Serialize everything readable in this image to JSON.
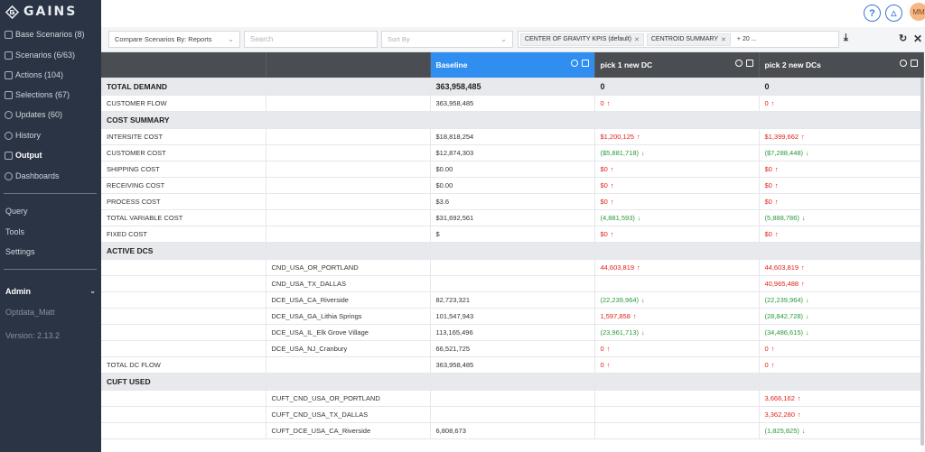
{
  "brand": {
    "name": "GAINS"
  },
  "sidebar": {
    "items": [
      {
        "label": "Base Scenarios (8)",
        "icon": "scenarios-icon"
      },
      {
        "label": "Scenarios (6/63)",
        "icon": "list-icon"
      },
      {
        "label": "Actions (104)",
        "icon": "actions-icon"
      },
      {
        "label": "Selections (67)",
        "icon": "selection-icon"
      },
      {
        "label": "Updates (60)",
        "icon": "refresh-icon"
      },
      {
        "label": "History",
        "icon": "history-icon"
      },
      {
        "label": "Output",
        "icon": "output-icon"
      },
      {
        "label": "Dashboards",
        "icon": "dashboard-icon"
      }
    ],
    "links": [
      "Query",
      "Tools",
      "Settings"
    ],
    "admin_label": "Admin",
    "user": "Optdata_Matt",
    "version": "Version: 2.13.2"
  },
  "topbar": {
    "help": "?",
    "notify": "△",
    "avatar": "MM"
  },
  "toolbar": {
    "compare": "Compare Scenarios By: Reports",
    "search_placeholder": "Search",
    "sort_placeholder": "Sort By",
    "chips": [
      "CENTER OF GRAVITY KPIS (default)",
      "CENTROID SUMMARY",
      "+ 20 ..."
    ],
    "download": "⤓",
    "refresh": "↻",
    "close": "✕"
  },
  "table": {
    "columns": [
      "Baseline",
      "pick 1 new DC",
      "pick 2 new DCs"
    ],
    "rows": [
      {
        "type": "section",
        "label": "TOTAL DEMAND",
        "sub": "",
        "values": [
          "363,958,485",
          "0",
          "0"
        ],
        "colors": [
          "",
          "",
          ""
        ]
      },
      {
        "type": "row",
        "label": "CUSTOMER FLOW",
        "sub": "",
        "values": [
          "363,958,485",
          "0",
          "0"
        ],
        "colors": [
          "",
          "red",
          "red"
        ]
      },
      {
        "type": "section",
        "label": "COST SUMMARY",
        "sub": "",
        "values": [
          "",
          "",
          ""
        ],
        "colors": [
          "",
          "",
          ""
        ]
      },
      {
        "type": "row",
        "label": "INTERSITE COST",
        "sub": "",
        "values": [
          "$18,818,254",
          "$1,200,125",
          "$1,399,662"
        ],
        "colors": [
          "",
          "red",
          "red"
        ]
      },
      {
        "type": "row",
        "label": "CUSTOMER COST",
        "sub": "",
        "values": [
          "$12,874,303",
          "($5,881,718)",
          "($7,288,448)"
        ],
        "colors": [
          "",
          "green",
          "green"
        ]
      },
      {
        "type": "row",
        "label": "SHIPPING COST",
        "sub": "",
        "values": [
          "$0.00",
          "$0",
          "$0"
        ],
        "colors": [
          "",
          "red",
          "red"
        ]
      },
      {
        "type": "row",
        "label": "RECEIVING COST",
        "sub": "",
        "values": [
          "$0.00",
          "$0",
          "$0"
        ],
        "colors": [
          "",
          "red",
          "red"
        ]
      },
      {
        "type": "row",
        "label": "PROCESS COST",
        "sub": "",
        "values": [
          "$3.6",
          "$0",
          "$0"
        ],
        "colors": [
          "",
          "red",
          "red"
        ]
      },
      {
        "type": "row",
        "label": "TOTAL VARIABLE COST",
        "sub": "",
        "values": [
          "$31,692,561",
          "(4,881,593)",
          "(5,888,786)"
        ],
        "colors": [
          "",
          "green",
          "green"
        ]
      },
      {
        "type": "row",
        "label": "FIXED COST",
        "sub": "",
        "values": [
          "$",
          "$0",
          "$0"
        ],
        "colors": [
          "",
          "red",
          "red"
        ]
      },
      {
        "type": "section",
        "label": "ACTIVE DCS",
        "sub": "",
        "values": [
          "",
          "",
          ""
        ],
        "colors": [
          "",
          "",
          ""
        ]
      },
      {
        "type": "row",
        "label": "",
        "sub": "CND_USA_OR_PORTLAND",
        "values": [
          "",
          "44,603,819",
          "44,603,819"
        ],
        "colors": [
          "",
          "red",
          "red"
        ]
      },
      {
        "type": "row",
        "label": "",
        "sub": "CND_USA_TX_DALLAS",
        "values": [
          "",
          "",
          "40,965,488"
        ],
        "colors": [
          "",
          "",
          "red"
        ]
      },
      {
        "type": "row",
        "label": "",
        "sub": "DCE_USA_CA_Riverside",
        "values": [
          "82,723,321",
          "(22,239,964)",
          "(22,239,964)"
        ],
        "colors": [
          "",
          "green",
          "green"
        ]
      },
      {
        "type": "row",
        "label": "",
        "sub": "DCE_USA_GA_Lithia Springs",
        "values": [
          "101,547,943",
          "1,597,858",
          "(28,842,728)"
        ],
        "colors": [
          "",
          "red",
          "green"
        ]
      },
      {
        "type": "row",
        "label": "",
        "sub": "DCE_USA_IL_Elk Grove Village",
        "values": [
          "113,165,496",
          "(23,961,713)",
          "(34,486,615)"
        ],
        "colors": [
          "",
          "green",
          "green"
        ]
      },
      {
        "type": "row",
        "label": "",
        "sub": "DCE_USA_NJ_Cranbury",
        "values": [
          "66,521,725",
          "0",
          "0"
        ],
        "colors": [
          "",
          "red",
          "red"
        ]
      },
      {
        "type": "row",
        "label": "TOTAL DC FLOW",
        "sub": "",
        "values": [
          "363,958,485",
          "0",
          "0"
        ],
        "colors": [
          "",
          "red",
          "red"
        ]
      },
      {
        "type": "section",
        "label": "CUFT USED",
        "sub": "",
        "values": [
          "",
          "",
          ""
        ],
        "colors": [
          "",
          "",
          ""
        ]
      },
      {
        "type": "row",
        "label": "",
        "sub": "CUFT_CND_USA_OR_PORTLAND",
        "values": [
          "",
          "",
          "3,666,162"
        ],
        "colors": [
          "",
          "",
          "red"
        ]
      },
      {
        "type": "row",
        "label": "",
        "sub": "CUFT_CND_USA_TX_DALLAS",
        "values": [
          "",
          "",
          "3,362,280"
        ],
        "colors": [
          "",
          "",
          "red"
        ]
      },
      {
        "type": "row",
        "label": "",
        "sub": "CUFT_DCE_USA_CA_Riverside",
        "values": [
          "6,808,673",
          "",
          "(1,825,825)"
        ],
        "colors": [
          "",
          "",
          "green"
        ]
      }
    ]
  },
  "colors": {
    "sidebar_bg": "#2b3445",
    "accent": "#2f8ef0",
    "increase": "#e0221c",
    "decrease": "#2a9a3a"
  }
}
